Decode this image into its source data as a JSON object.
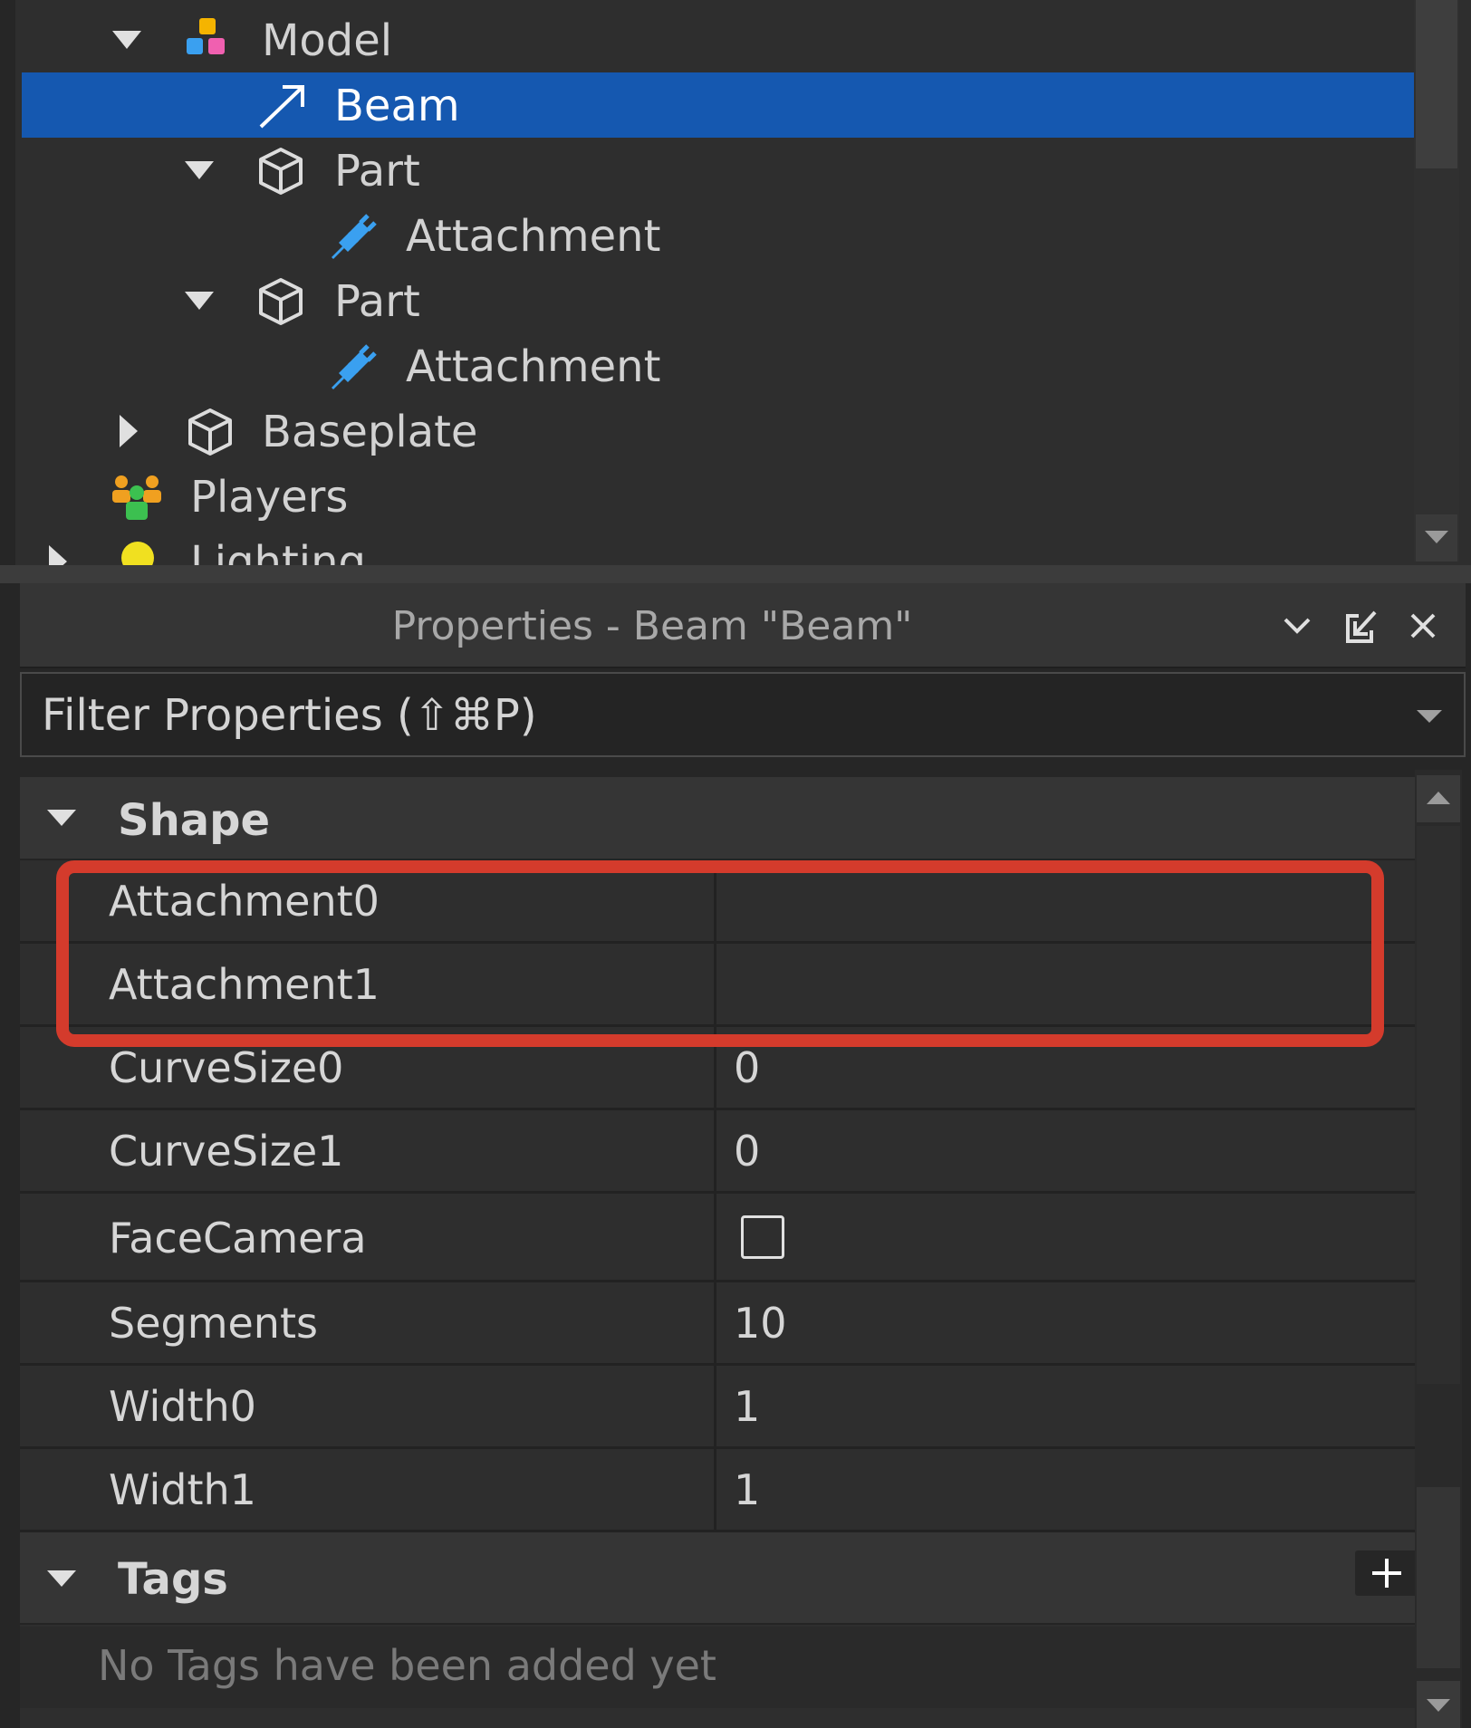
{
  "explorer": {
    "items": [
      {
        "label": "Model",
        "icon": "model-icon"
      },
      {
        "label": "Beam",
        "icon": "beam-icon",
        "selected": true
      },
      {
        "label": "Part",
        "icon": "part-icon"
      },
      {
        "label": "Attachment",
        "icon": "attachment-icon"
      },
      {
        "label": "Part",
        "icon": "part-icon"
      },
      {
        "label": "Attachment",
        "icon": "attachment-icon"
      },
      {
        "label": "Baseplate",
        "icon": "part-icon"
      },
      {
        "label": "Players",
        "icon": "players-icon"
      },
      {
        "label": "Lighting",
        "icon": "lighting-icon"
      }
    ]
  },
  "properties": {
    "title": "Properties - Beam \"Beam\"",
    "filter_placeholder": "Filter Properties (⇧⌘P)",
    "categories": {
      "shape": "Shape",
      "tags": "Tags"
    },
    "rows": [
      {
        "name": "Attachment0",
        "value": ""
      },
      {
        "name": "Attachment1",
        "value": ""
      },
      {
        "name": "CurveSize0",
        "value": "0"
      },
      {
        "name": "CurveSize1",
        "value": "0"
      },
      {
        "name": "FaceCamera",
        "value": "",
        "checked": false
      },
      {
        "name": "Segments",
        "value": "10"
      },
      {
        "name": "Width0",
        "value": "1"
      },
      {
        "name": "Width1",
        "value": "1"
      }
    ],
    "empty_tags": "No Tags have been added yet"
  },
  "colors": {
    "selection": "#1558b0",
    "highlight": "#d43b2c",
    "attachment": "#3aa0f0"
  }
}
